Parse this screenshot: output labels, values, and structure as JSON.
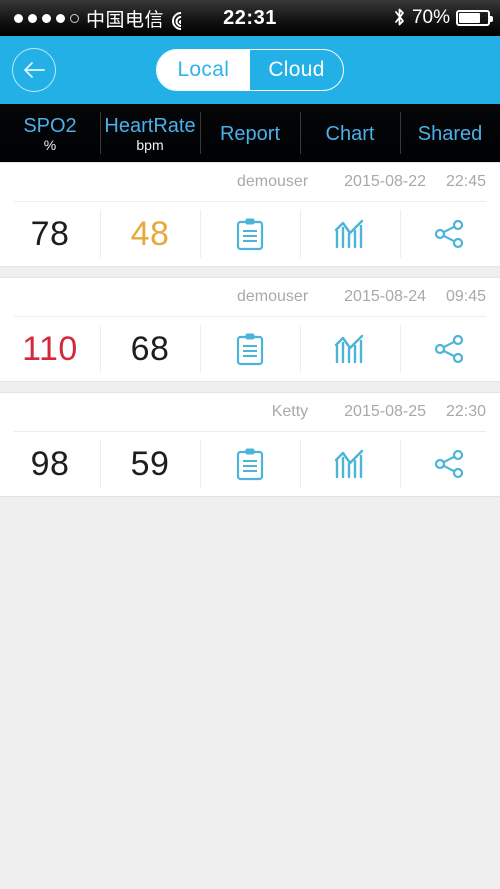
{
  "status_bar": {
    "signal_dots_total": 5,
    "signal_dots_filled": 4,
    "carrier": "中国电信",
    "wifi_icon": "wifi-icon",
    "time": "22:31",
    "bluetooth_icon": "bluetooth-icon",
    "battery_text": "70%",
    "battery_level": 70
  },
  "navbar": {
    "back_icon": "back-arrow-icon",
    "segmented": {
      "options": [
        "Local",
        "Cloud"
      ],
      "selected": "Local",
      "local_label": "Local",
      "cloud_label": "Cloud"
    }
  },
  "column_header": {
    "columns": [
      {
        "title": "SPO2",
        "unit": "%"
      },
      {
        "title": "HeartRate",
        "unit": "bpm"
      },
      {
        "title": "Report",
        "unit": ""
      },
      {
        "title": "Chart",
        "unit": ""
      },
      {
        "title": "Shared",
        "unit": ""
      }
    ]
  },
  "records": [
    {
      "user": "demouser",
      "date": "2015-08-22",
      "time": "22:45",
      "spo2": "78",
      "spo2_state": "normal",
      "heart_rate": "48",
      "heart_rate_state": "warn",
      "report_icon": "clipboard-icon",
      "chart_icon": "bar-chart-icon",
      "share_icon": "share-icon"
    },
    {
      "user": "demouser",
      "date": "2015-08-24",
      "time": "09:45",
      "spo2": "110",
      "spo2_state": "danger",
      "heart_rate": "68",
      "heart_rate_state": "normal",
      "report_icon": "clipboard-icon",
      "chart_icon": "bar-chart-icon",
      "share_icon": "share-icon"
    },
    {
      "user": "Ketty",
      "date": "2015-08-25",
      "time": "22:30",
      "spo2": "98",
      "spo2_state": "normal",
      "heart_rate": "59",
      "heart_rate_state": "normal",
      "report_icon": "clipboard-icon",
      "chart_icon": "bar-chart-icon",
      "share_icon": "share-icon"
    }
  ],
  "colors": {
    "accent_blue": "#22b0e6",
    "header_text_blue": "#4cb0e8",
    "icon_teal": "#4cb4d8",
    "warn": "#e8a93a",
    "danger": "#d3293d",
    "page_background": "#efefef"
  }
}
